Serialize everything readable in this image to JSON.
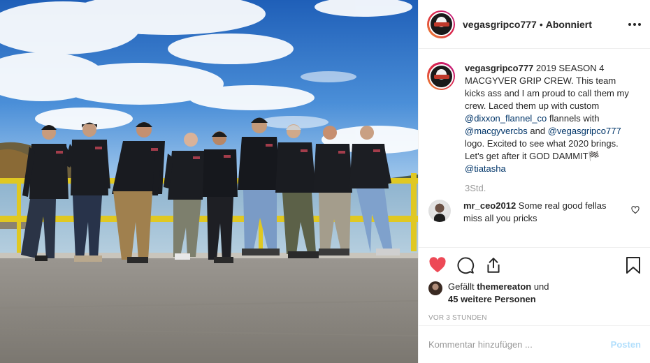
{
  "post": {
    "username": "vegasgripco777",
    "follow_status": "Abonniert",
    "separator": "•"
  },
  "caption": {
    "username": "vegasgripco777",
    "text_1": " 2019 SEASON 4 MACGYVER GRIP CREW. This team kicks ass and I am proud to call them my crew. Laced them up with custom ",
    "mention_1": "@dixxon_flannel_co",
    "text_2": " flannels with ",
    "mention_2": "@macgyvercbs",
    "text_3": " and ",
    "mention_3": "@vegasgripco777",
    "text_4": " logo. Excited to see what 2020 brings. Let's get after it GOD DAMMIT🏁 ",
    "mention_4": "@tiatasha",
    "time": "3Std."
  },
  "comment": {
    "username": "mr_ceo2012",
    "text": " Some real good fellas miss all you pricks"
  },
  "likes": {
    "prefix": "Gefällt ",
    "user": "themereaton",
    "middle": " und",
    "others": "45 weitere Personen"
  },
  "timestamp": "VOR 3 STUNDEN",
  "add_comment": {
    "placeholder": "Kommentar hinzufügen ...",
    "post_label": "Posten"
  },
  "colors": {
    "liked_heart": "#ed4956",
    "mention": "#003569",
    "post_disabled": "#b2dffc",
    "muted": "#999999"
  },
  "icons": [
    "more-icon",
    "heart-filled-icon",
    "comment-icon",
    "share-icon",
    "bookmark-icon",
    "heart-outline-icon"
  ]
}
